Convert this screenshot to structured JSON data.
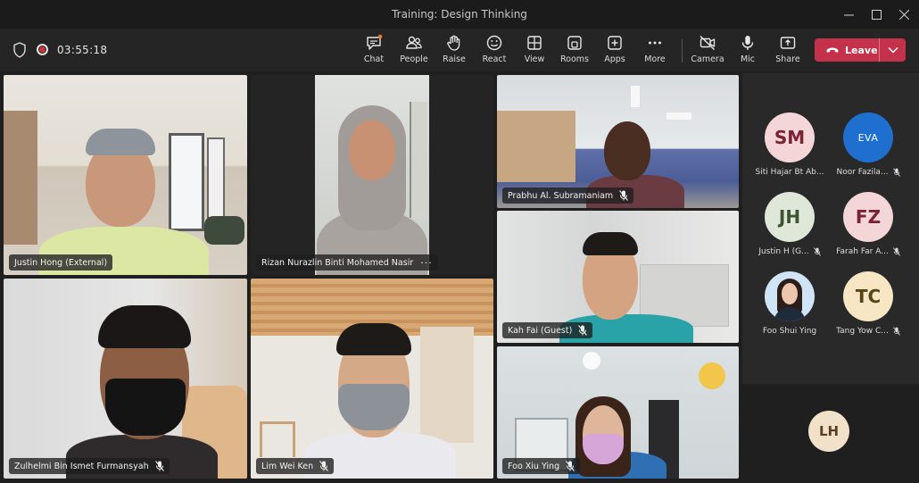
{
  "window": {
    "title": "Training: Design Thinking"
  },
  "toolbar": {
    "timer": "03:55:18",
    "buttons": [
      {
        "label": "Chat",
        "icon": "chat-icon"
      },
      {
        "label": "People",
        "icon": "people-icon"
      },
      {
        "label": "Raise",
        "icon": "raise-hand-icon"
      },
      {
        "label": "React",
        "icon": "react-icon"
      },
      {
        "label": "View",
        "icon": "view-grid-icon"
      },
      {
        "label": "Rooms",
        "icon": "rooms-icon"
      },
      {
        "label": "Apps",
        "icon": "apps-icon"
      },
      {
        "label": "More",
        "icon": "more-icon"
      },
      {
        "label": "Camera",
        "icon": "camera-off-icon"
      },
      {
        "label": "Mic",
        "icon": "mic-icon"
      },
      {
        "label": "Share",
        "icon": "share-icon"
      }
    ],
    "leave_label": "Leave",
    "leave_color": "#c4314b"
  },
  "tiles": [
    {
      "name": "Justin Hong (External)"
    },
    {
      "name": "Rizan Nurazlin Binti Mohamed Nasir"
    },
    {
      "name": "Prabhu Al. Subramaniam"
    },
    {
      "name": "Kah Fai (Guest)"
    },
    {
      "name": "Zulhelmi Bin Ismet Furmansyah"
    },
    {
      "name": "Lim Wei Ken"
    },
    {
      "name": "Foo Xiu Ying"
    }
  ],
  "roster": [
    {
      "initials": "SM",
      "name": "Siti Hajar Bt Ab...",
      "bg": "#f4d5d8",
      "fg": "#7a2433"
    },
    {
      "initials": "EVA",
      "name": "Noor Fazila...",
      "bg": "#1f6fd1",
      "fg": "#ffffff"
    },
    {
      "initials": "JH",
      "name": "Justin H (G...",
      "bg": "#dfe8d8",
      "fg": "#3c5230"
    },
    {
      "initials": "FZ",
      "name": "Farah Far A...",
      "bg": "#f4d5d8",
      "fg": "#7a2433"
    },
    {
      "initials": "",
      "name": "Foo Shui Ying",
      "bg": "#cfe4f7",
      "fg": "#1f3d5c"
    },
    {
      "initials": "TC",
      "name": "Tang Yow C...",
      "bg": "#f6e6c4",
      "fg": "#5a4216"
    }
  ],
  "overflow": {
    "initials": "LH"
  }
}
